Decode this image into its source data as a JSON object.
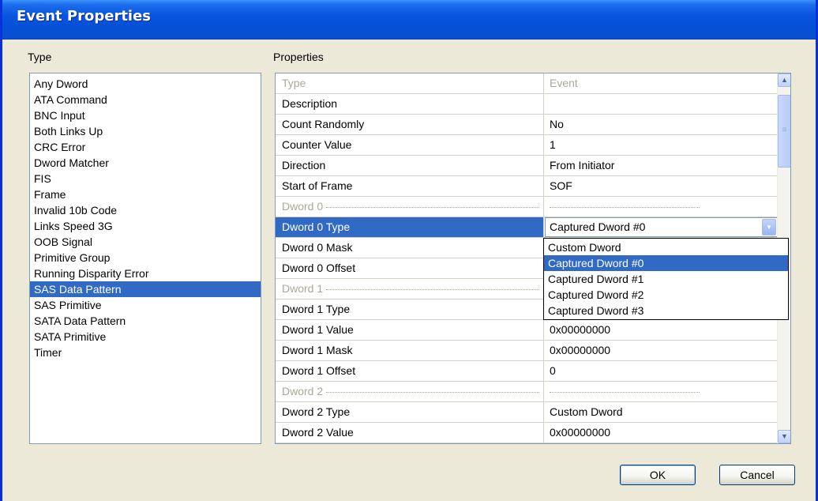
{
  "window": {
    "title": "Event Properties"
  },
  "type_panel": {
    "label": "Type",
    "items": [
      "Any Dword",
      "ATA Command",
      "BNC Input",
      "Both Links Up",
      "CRC Error",
      "Dword Matcher",
      "FIS",
      "Frame",
      "Invalid 10b Code",
      "Links Speed 3G",
      "OOB Signal",
      "Primitive Group",
      "Running Disparity Error",
      "SAS Data Pattern",
      "SAS Primitive",
      "SATA Data Pattern",
      "SATA Primitive",
      "Timer"
    ],
    "selected": "SAS Data Pattern"
  },
  "properties_panel": {
    "label": "Properties",
    "rows": [
      {
        "name": "Type",
        "value": "Event",
        "disabled": true
      },
      {
        "name": "Description",
        "value": ""
      },
      {
        "name": "Count Randomly",
        "value": "No"
      },
      {
        "name": "Counter Value",
        "value": "1"
      },
      {
        "name": "Direction",
        "value": "From Initiator"
      },
      {
        "name": "Start of Frame",
        "value": "SOF"
      },
      {
        "name": "Dword 0",
        "value": "",
        "separator": true
      },
      {
        "name": "Dword 0 Type",
        "value": "Captured Dword #0",
        "selected": true,
        "combo": true
      },
      {
        "name": "Dword 0 Mask",
        "value": ""
      },
      {
        "name": "Dword 0 Offset",
        "value": ""
      },
      {
        "name": "Dword 1",
        "value": "",
        "separator": true
      },
      {
        "name": "Dword 1 Type",
        "value": ""
      },
      {
        "name": "Dword 1 Value",
        "value": "0x00000000"
      },
      {
        "name": "Dword 1 Mask",
        "value": "0x00000000"
      },
      {
        "name": "Dword 1 Offset",
        "value": "0"
      },
      {
        "name": "Dword 2",
        "value": "",
        "separator": true
      },
      {
        "name": "Dword 2 Type",
        "value": "Custom Dword"
      },
      {
        "name": "Dword 2 Value",
        "value": "0x00000000"
      }
    ]
  },
  "dropdown": {
    "options": [
      "Custom Dword",
      "Captured Dword #0",
      "Captured Dword #1",
      "Captured Dword #2",
      "Captured Dword #3"
    ],
    "selected": "Captured Dword #0"
  },
  "buttons": {
    "ok": "OK",
    "cancel": "Cancel"
  },
  "colors": {
    "selection": "#316ac5",
    "title_bar": "#0a55e0",
    "dialog_bg": "#ece9d8",
    "disabled_text": "#aca899"
  }
}
